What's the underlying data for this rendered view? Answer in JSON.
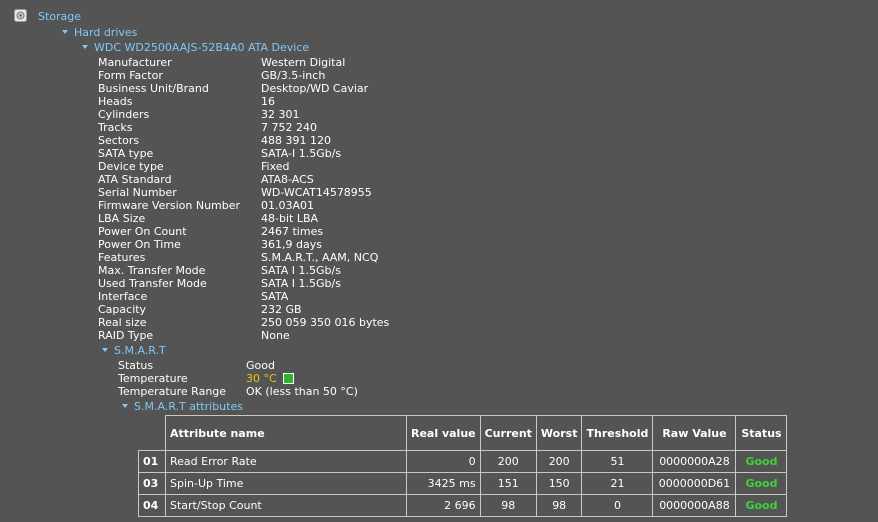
{
  "tree": {
    "storage_label": "Storage",
    "hard_drives_label": "Hard drives",
    "device_label": "WDC WD2500AAJS-52B4A0 ATA Device",
    "smart_label": "S.M.A.R.T",
    "smart_attributes_label": "S.M.A.R.T attributes"
  },
  "device_props": [
    {
      "label": "Manufacturer",
      "value": "Western Digital"
    },
    {
      "label": "Form Factor",
      "value": "GB/3.5-inch"
    },
    {
      "label": "Business Unit/Brand",
      "value": "Desktop/WD Caviar"
    },
    {
      "label": "Heads",
      "value": "16"
    },
    {
      "label": "Cylinders",
      "value": "32 301"
    },
    {
      "label": "Tracks",
      "value": "7 752 240"
    },
    {
      "label": "Sectors",
      "value": "488 391 120"
    },
    {
      "label": "SATA type",
      "value": "SATA-I 1.5Gb/s"
    },
    {
      "label": "Device type",
      "value": "Fixed"
    },
    {
      "label": "ATA Standard",
      "value": "ATA8-ACS"
    },
    {
      "label": "Serial Number",
      "value": "WD-WCAT14578955"
    },
    {
      "label": "Firmware Version Number",
      "value": "01.03A01"
    },
    {
      "label": "LBA Size",
      "value": "48-bit LBA"
    },
    {
      "label": "Power On Count",
      "value": "2467 times"
    },
    {
      "label": "Power On Time",
      "value": "361,9 days"
    },
    {
      "label": "Features",
      "value": "S.M.A.R.T., AAM, NCQ"
    },
    {
      "label": "Max. Transfer Mode",
      "value": "SATA I 1.5Gb/s"
    },
    {
      "label": "Used Transfer Mode",
      "value": "SATA I 1.5Gb/s"
    },
    {
      "label": "Interface",
      "value": "SATA"
    },
    {
      "label": "Capacity",
      "value": "232 GB"
    },
    {
      "label": "Real size",
      "value": "250 059 350 016 bytes"
    },
    {
      "label": "RAID Type",
      "value": "None"
    }
  ],
  "smart": {
    "status_label": "Status",
    "status_value": "Good",
    "temperature_label": "Temperature",
    "temperature_value": "30 °C",
    "temperature_range_label": "Temperature Range",
    "temperature_range_value": "OK (less than 50 °C)"
  },
  "smart_table": {
    "headers": {
      "name": "Attribute name",
      "real": "Real value",
      "current": "Current",
      "worst": "Worst",
      "threshold": "Threshold",
      "raw": "Raw Value",
      "status": "Status"
    },
    "rows": [
      {
        "id": "01",
        "name": "Read Error Rate",
        "real": "0",
        "current": "200",
        "worst": "200",
        "threshold": "51",
        "raw": "0000000A28",
        "status": "Good"
      },
      {
        "id": "03",
        "name": "Spin-Up Time",
        "real": "3425 ms",
        "current": "151",
        "worst": "150",
        "threshold": "21",
        "raw": "0000000D61",
        "status": "Good"
      },
      {
        "id": "04",
        "name": "Start/Stop Count",
        "real": "2 696",
        "current": "98",
        "worst": "98",
        "threshold": "0",
        "raw": "0000000A88",
        "status": "Good"
      }
    ]
  },
  "colors": {
    "background": "#545454",
    "node_text": "#7fc8f8",
    "temperature": "#f0c800",
    "good_status": "#3cd23c"
  }
}
